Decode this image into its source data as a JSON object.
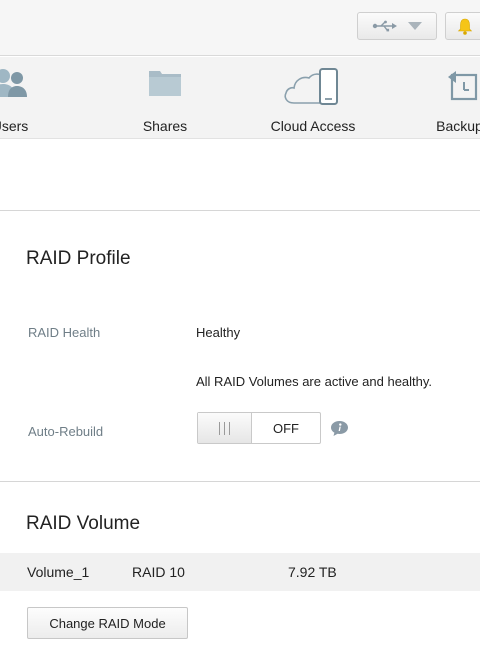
{
  "header": {
    "usb_icon": "usb-icon",
    "dropdown_icon": "chevron-down-icon",
    "bell_icon": "bell-icon",
    "accent": "#f5c518"
  },
  "nav": {
    "items": [
      {
        "label": "Users",
        "icon": "users-icon"
      },
      {
        "label": "Shares",
        "icon": "folder-icon"
      },
      {
        "label": "Cloud Access",
        "icon": "cloud-device-icon"
      },
      {
        "label": "Backups",
        "icon": "backup-icon"
      }
    ]
  },
  "raid_profile": {
    "title": "RAID Profile",
    "health_label": "RAID Health",
    "health_value": "Healthy",
    "health_detail": "All RAID Volumes are active and healthy.",
    "auto_rebuild_label": "Auto-Rebuild",
    "auto_rebuild_state": "OFF"
  },
  "raid_volume": {
    "title": "RAID Volume",
    "rows": [
      {
        "name": "Volume_1",
        "mode": "RAID 10",
        "size": "7.92 TB"
      }
    ],
    "change_button": "Change RAID Mode"
  }
}
